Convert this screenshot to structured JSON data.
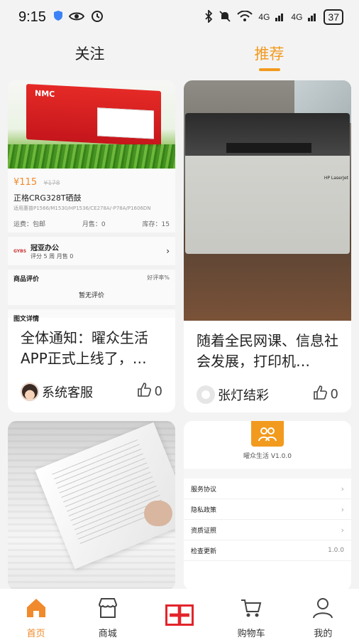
{
  "status_bar": {
    "time": "9:15",
    "network": "4G",
    "battery": "37"
  },
  "tabs": [
    {
      "label": "关注"
    },
    {
      "label": "推荐"
    }
  ],
  "feed": [
    {
      "type": "product-screenshot",
      "product": {
        "brand_text": "NMC",
        "price": "¥115",
        "old_price": "¥178",
        "name": "正格CRG328T硒鼓",
        "spec": "适用惠普P1566/M1530/HP1536/CE278A/-P78A/P1606DN",
        "shipping": "运费：包邮",
        "monthly_sales": "月售：0",
        "stock": "库存：15",
        "shop_logo": "GYBS",
        "shop_name": "冠亚办公",
        "shop_sub": "评分 5 周 月售 0",
        "review_title": "商品评价",
        "review_rate": "好评率%",
        "no_review": "暂无评价",
        "detail_title": "图文详情"
      },
      "title": "全体通知：曜众生活APP正式上线了，…",
      "author": "系统客服",
      "likes": "0"
    },
    {
      "type": "printer-photo",
      "photo_label": "HP LaserJet",
      "title": "随着全民网课、信息社会发展，打印机…",
      "author": "张灯结彩",
      "likes": "0"
    },
    {
      "type": "paper-photo"
    },
    {
      "type": "about-screenshot",
      "app_version": "曜众生活 V1.0.0",
      "rows": [
        {
          "label": "服务协议",
          "value": ""
        },
        {
          "label": "隐私政策",
          "value": ""
        },
        {
          "label": "资质证照",
          "value": ""
        },
        {
          "label": "检查更新",
          "value": "1.0.0"
        }
      ]
    }
  ],
  "nav": [
    {
      "label": "首页",
      "icon": "home-icon",
      "active": true
    },
    {
      "label": "商城",
      "icon": "shop-icon"
    },
    {
      "label": "",
      "icon": "add-icon"
    },
    {
      "label": "购物车",
      "icon": "cart-icon"
    },
    {
      "label": "我的",
      "icon": "profile-icon"
    }
  ],
  "colors": {
    "accent": "#f29a1d",
    "add_button_border": "#e3242b"
  }
}
